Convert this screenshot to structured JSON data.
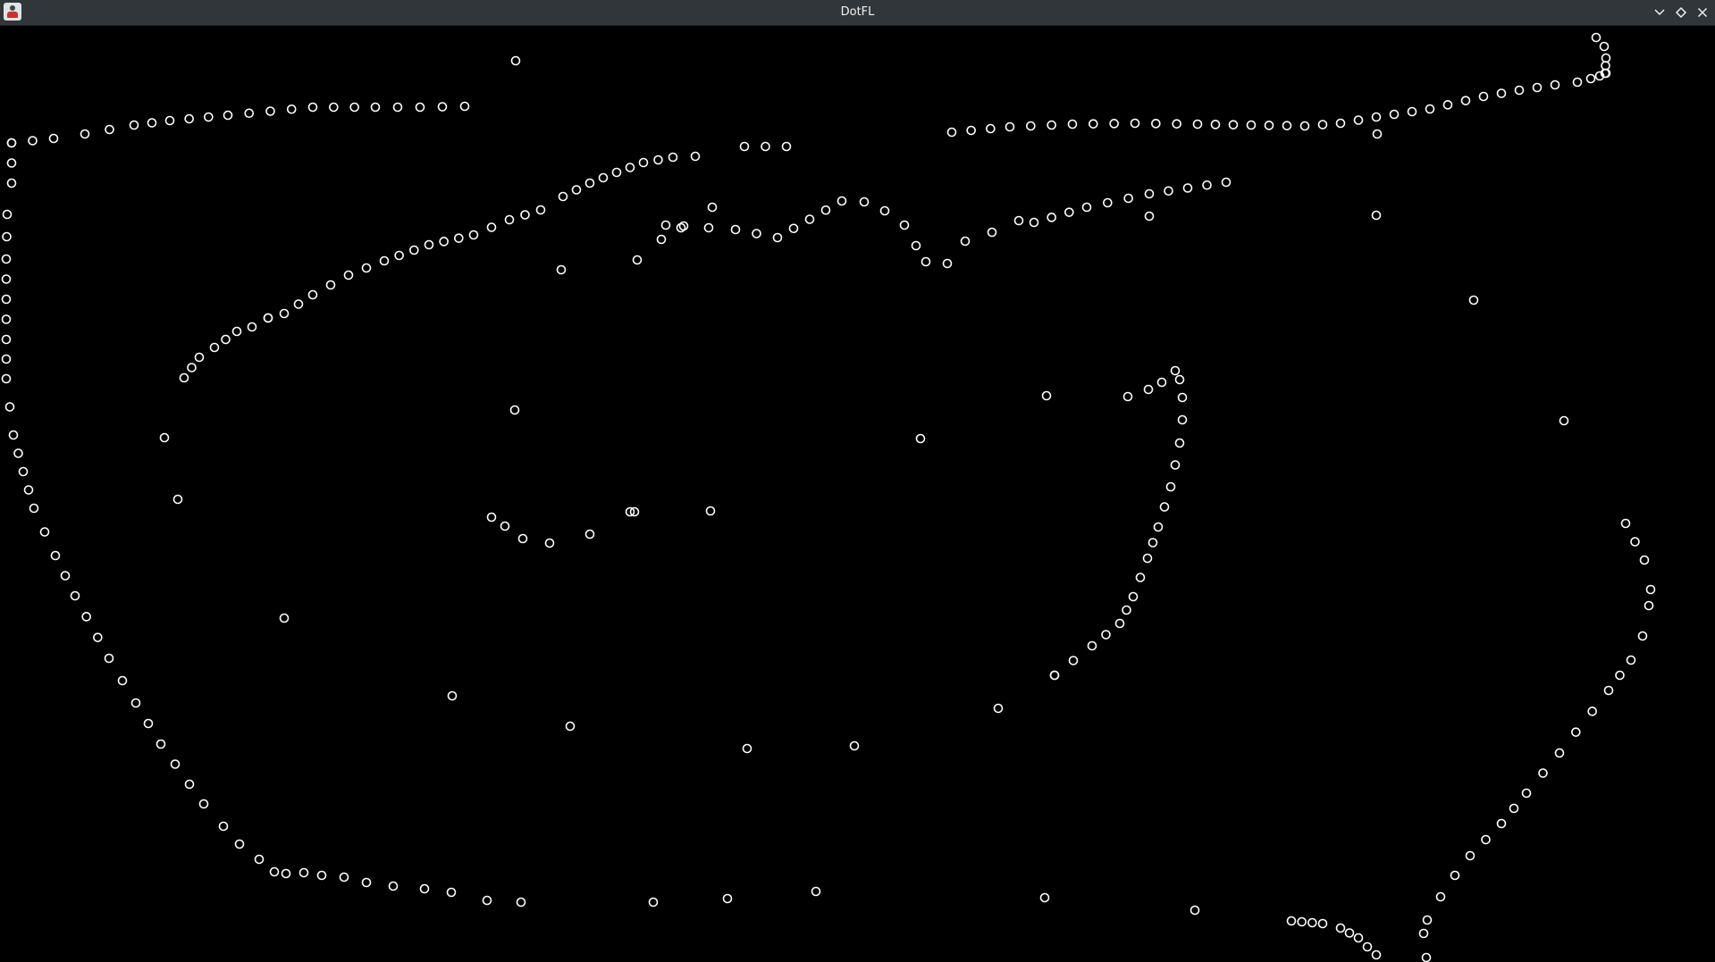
{
  "window": {
    "title": "DotFL",
    "app_icon": "dotfl-app-icon",
    "controls": [
      {
        "name": "minimize-button",
        "icon": "chevron-down-icon"
      },
      {
        "name": "maximize-button",
        "icon": "diamond-icon"
      },
      {
        "name": "close-button",
        "icon": "close-icon"
      }
    ]
  },
  "canvas": {
    "background": "#000000",
    "dot_color": "#ffffff"
  }
}
